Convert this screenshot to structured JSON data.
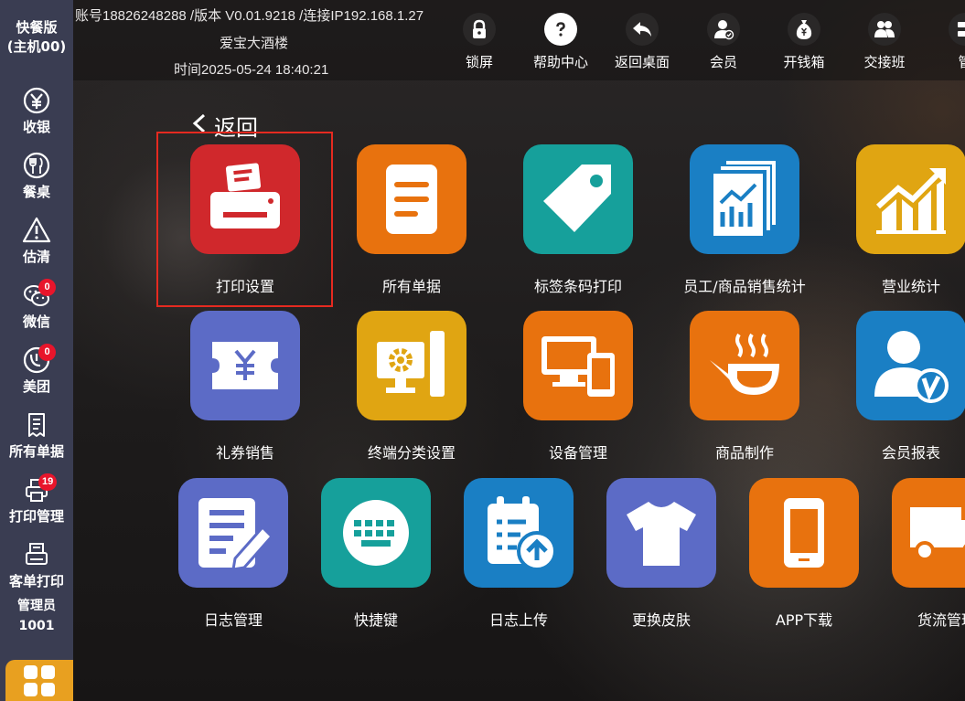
{
  "sidebar": {
    "mode_line1": "快餐版",
    "mode_line2": "(主机00)",
    "items": [
      {
        "label": "收银",
        "icon": "yen-circle-icon"
      },
      {
        "label": "餐桌",
        "icon": "fork-knife-icon"
      },
      {
        "label": "估清",
        "icon": "warning-triangle-icon"
      },
      {
        "label": "微信",
        "icon": "wechat-icon",
        "badge": "0"
      },
      {
        "label": "美团",
        "icon": "meituan-icon",
        "badge": "0"
      },
      {
        "label": "所有单据",
        "icon": "receipt-icon"
      },
      {
        "label": "打印管理",
        "icon": "printer-icon",
        "badge": "19"
      },
      {
        "label": "客单打印",
        "icon": "ticket-printer-icon"
      }
    ],
    "user_role": "管理员",
    "user_id": "1001",
    "home_icon": "apps-grid-icon"
  },
  "header": {
    "account_line": "账号18826248288 /版本 V0.01.9218 /连接IP192.168.1.27",
    "store_name": "爱宝大酒楼",
    "time_line": "时间2025-05-24 18:40:21",
    "buttons": [
      {
        "label": "锁屏",
        "icon": "lock-icon"
      },
      {
        "label": "帮助中心",
        "icon": "help-icon"
      },
      {
        "label": "返回桌面",
        "icon": "return-icon"
      },
      {
        "label": "会员",
        "icon": "member-icon"
      },
      {
        "label": "开钱箱",
        "icon": "money-bag-icon"
      },
      {
        "label": "交接班",
        "icon": "handover-icon"
      },
      {
        "label": "管",
        "icon": "manage-icon"
      }
    ]
  },
  "main": {
    "back_label": "返回",
    "tiles": [
      {
        "label": "打印设置",
        "color": "#d0282c",
        "icon": "printer-icon"
      },
      {
        "label": "所有单据",
        "color": "#e8720e",
        "icon": "document-icon"
      },
      {
        "label": "标签条码打印",
        "color": "#16a09b",
        "icon": "tag-icon"
      },
      {
        "label": "员工/商品销售统计",
        "color": "#1a7fc4",
        "icon": "report-chart-icon"
      },
      {
        "label": "营业统计",
        "color": "#e0a512",
        "icon": "growth-chart-icon"
      },
      {
        "label": "礼券销售",
        "color": "#5c6bc6",
        "icon": "coupon-icon"
      },
      {
        "label": "终端分类设置",
        "color": "#e0a512",
        "icon": "terminal-settings-icon"
      },
      {
        "label": "设备管理",
        "color": "#e8720e",
        "icon": "devices-icon"
      },
      {
        "label": "商品制作",
        "color": "#e8720e",
        "icon": "cooking-pot-icon"
      },
      {
        "label": "会员报表",
        "color": "#1a7fc4",
        "icon": "member-report-icon"
      },
      {
        "label": "日志管理",
        "color": "#5c6bc6",
        "icon": "edit-log-icon"
      },
      {
        "label": "快捷键",
        "color": "#16a09b",
        "icon": "keyboard-icon"
      },
      {
        "label": "日志上传",
        "color": "#1a7fc4",
        "icon": "log-upload-icon"
      },
      {
        "label": "更换皮肤",
        "color": "#5c6bc6",
        "icon": "tshirt-icon"
      },
      {
        "label": "APP下载",
        "color": "#e8720e",
        "icon": "phone-icon"
      },
      {
        "label": "货流管理",
        "color": "#e8720e",
        "icon": "truck-icon"
      }
    ]
  },
  "colors": {
    "sidebar_bg": "#3a3d52",
    "badge": "#e8152b",
    "selection_frame": "#e52a20",
    "home_button": "#e8a020"
  }
}
